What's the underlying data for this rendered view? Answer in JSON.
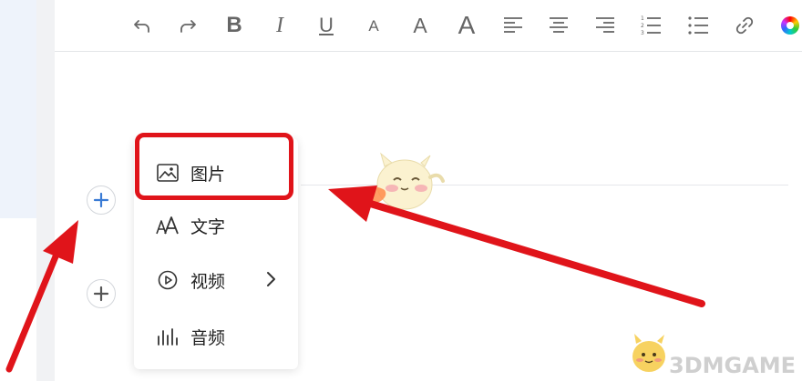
{
  "toolbar": {
    "buttons": [
      {
        "id": "undo",
        "icon": "undo-icon"
      },
      {
        "id": "redo",
        "icon": "redo-icon"
      },
      {
        "id": "bold",
        "label": "B",
        "icon": "bold-icon"
      },
      {
        "id": "italic",
        "label": "I",
        "icon": "italic-icon"
      },
      {
        "id": "underline",
        "label": "U",
        "icon": "underline-icon"
      },
      {
        "id": "font-small",
        "label": "A",
        "icon": "font-size-small-icon"
      },
      {
        "id": "font-medium",
        "label": "A",
        "icon": "font-size-medium-icon"
      },
      {
        "id": "font-large",
        "label": "A",
        "icon": "font-size-large-icon"
      },
      {
        "id": "align-left",
        "icon": "align-left-icon"
      },
      {
        "id": "align-center",
        "icon": "align-center-icon"
      },
      {
        "id": "align-right",
        "icon": "align-right-icon"
      },
      {
        "id": "ordered-list",
        "icon": "ordered-list-icon"
      },
      {
        "id": "bullet-list",
        "icon": "bullet-list-icon"
      },
      {
        "id": "link",
        "icon": "link-icon"
      },
      {
        "id": "color",
        "icon": "color-wheel-icon"
      }
    ]
  },
  "insert_menu": {
    "items": [
      {
        "label": "图片",
        "icon": "image-icon",
        "highlighted": true
      },
      {
        "label": "文字",
        "icon": "text-icon"
      },
      {
        "label": "视频",
        "icon": "video-icon",
        "has_submenu": true
      },
      {
        "label": "音频",
        "icon": "audio-icon"
      }
    ]
  },
  "watermark": {
    "text": "3DMGAME"
  },
  "colors": {
    "annotation_red": "#e0141a",
    "add_button_blue": "#3a7bd5"
  }
}
